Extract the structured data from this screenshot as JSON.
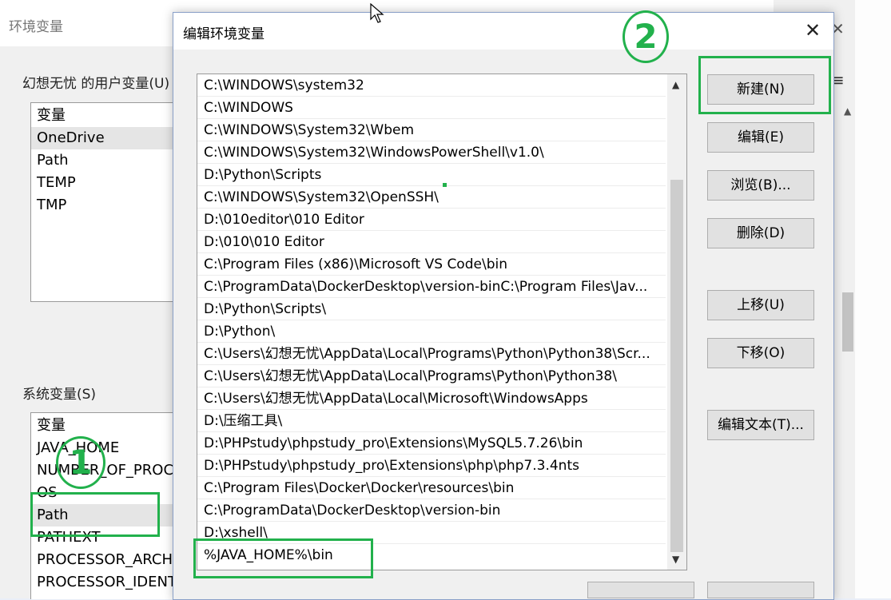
{
  "background_window": {
    "title": "环境变量",
    "user_vars_label": "幻想无忧 的用户变量(U)",
    "user_vars": {
      "header": "变量",
      "rows": [
        "OneDrive",
        "Path",
        "TEMP",
        "TMP"
      ]
    },
    "sys_vars_label": "系统变量(S)",
    "sys_vars": {
      "header": "变量",
      "rows": [
        "JAVA_HOME",
        "NUMBER_OF_PROC",
        "OS",
        "Path",
        "PATHEXT",
        "PROCESSOR_ARCHI",
        "PROCESSOR_IDENTI"
      ]
    }
  },
  "dialog": {
    "title": "编辑环境变量",
    "close_glyph": "✕",
    "paths": [
      "C:\\WINDOWS\\system32",
      "C:\\WINDOWS",
      "C:\\WINDOWS\\System32\\Wbem",
      "C:\\WINDOWS\\System32\\WindowsPowerShell\\v1.0\\",
      "D:\\Python\\Scripts",
      "C:\\WINDOWS\\System32\\OpenSSH\\",
      "D:\\010editor\\010 Editor",
      "D:\\010\\010 Editor",
      "C:\\Program Files (x86)\\Microsoft VS Code\\bin",
      "C:\\ProgramData\\DockerDesktop\\version-binC:\\Program Files\\Jav...",
      "D:\\Python\\Scripts\\",
      "D:\\Python\\",
      "C:\\Users\\幻想无忧\\AppData\\Local\\Programs\\Python\\Python38\\Scr...",
      "C:\\Users\\幻想无忧\\AppData\\Local\\Programs\\Python\\Python38\\",
      "C:\\Users\\幻想无忧\\AppData\\Local\\Microsoft\\WindowsApps",
      "D:\\压缩工具\\",
      "D:\\PHPstudy\\phpstudy_pro\\Extensions\\MySQL5.7.26\\bin",
      "D:\\PHPstudy\\phpstudy_pro\\Extensions\\php\\php7.3.4nts",
      "C:\\Program Files\\Docker\\Docker\\resources\\bin",
      "C:\\ProgramData\\DockerDesktop\\version-bin",
      "D:\\xshell\\",
      "%JAVA_HOME%\\bin"
    ],
    "buttons": {
      "new": "新建(N)",
      "edit": "编辑(E)",
      "browse": "浏览(B)...",
      "delete": "删除(D)",
      "up": "上移(U)",
      "down": "下移(O)",
      "edit_text": "编辑文本(T)..."
    }
  },
  "annotations": {
    "step1": "1",
    "step2": "2",
    "color": "#22b14c"
  },
  "icons": {
    "scroll_up": "▲",
    "scroll_down": "▼",
    "menu": "≡",
    "bg_close": "✕",
    "small_up": "▲"
  }
}
